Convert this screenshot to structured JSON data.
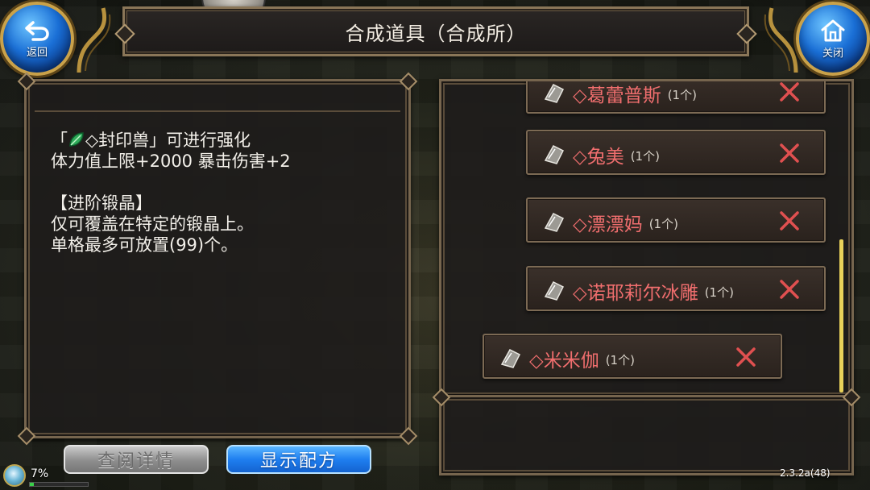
{
  "header": {
    "title": "合成道具（合成所）",
    "back_button": {
      "label": "返回",
      "icon": "back-arrow-icon"
    },
    "close_button": {
      "label": "关闭",
      "icon": "home-icon"
    }
  },
  "description": {
    "line1_open": "「",
    "line1_item": "◇封印兽",
    "line1_close": "」可进行强化",
    "line2": "体力值上限+2000 暴击伤害+2",
    "line3": "【进阶锻晶】",
    "line4": "仅可覆盖在特定的锻晶上。",
    "line5": "单格最多可放置(99)个。",
    "item_icon": "green-leaf-icon"
  },
  "materials": {
    "items": [
      {
        "name": "◇葛蕾普斯",
        "count": "(1个)"
      },
      {
        "name": "◇兔美",
        "count": "(1个)"
      },
      {
        "name": "◇漂漂妈",
        "count": "(1个)"
      },
      {
        "name": "◇诺耶莉尔冰雕",
        "count": "(1个)"
      },
      {
        "name": "◇米米伽",
        "count": "(1个)"
      }
    ],
    "item_icon": "crystal-shard-icon",
    "remove_icon": "x-remove-icon",
    "name_color": "#f06e6e",
    "scroll_position": 0.55
  },
  "buttons": {
    "details": "查阅详情",
    "show_recipe": "显示配方"
  },
  "status": {
    "percent": "7%",
    "progress": 0.07,
    "version": "2.3.2a(48)"
  },
  "colors": {
    "accent_blue": "#1f7ff0",
    "frame_gold": "#caa24a",
    "remove_red": "#e05050"
  }
}
